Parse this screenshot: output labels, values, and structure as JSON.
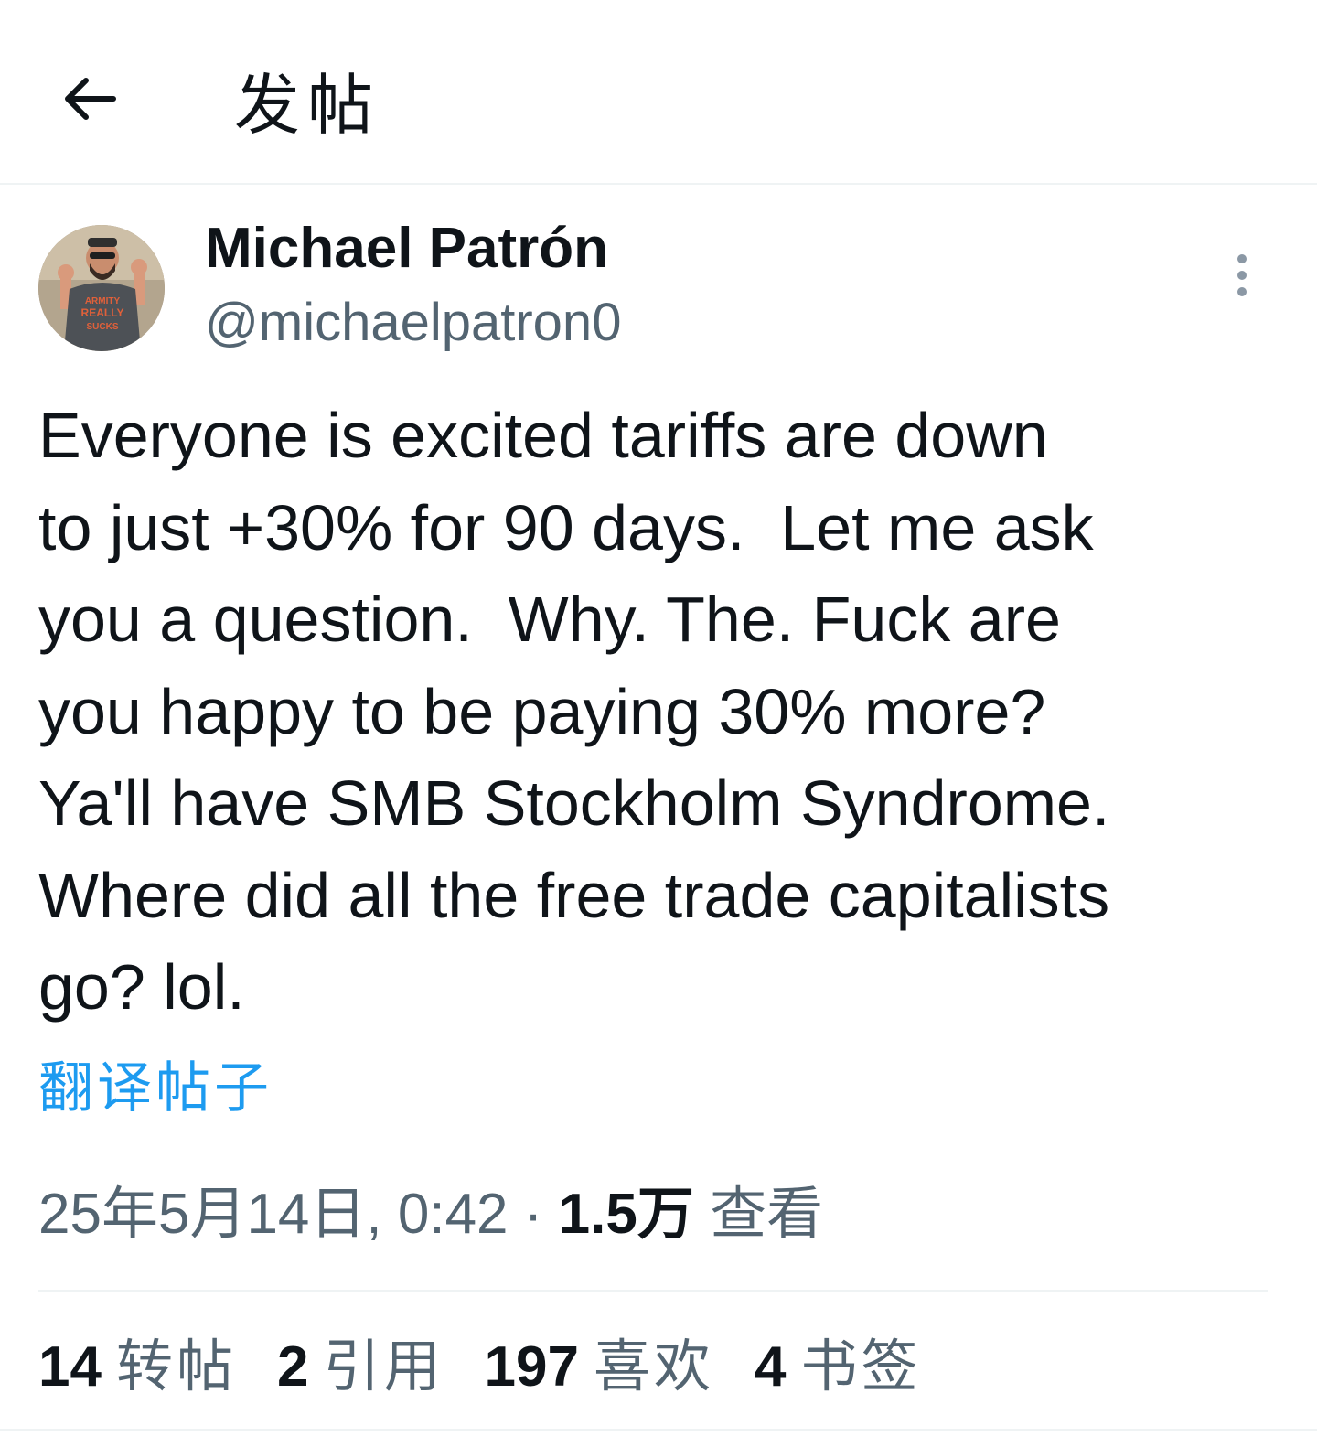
{
  "header": {
    "title": "发帖",
    "back_icon": "arrow-left-icon"
  },
  "author": {
    "name": "Michael Patrón",
    "handle": "@michaelpatron0",
    "avatar_shirt_text": [
      "ARMITY",
      "REALLY",
      "SUCKS"
    ]
  },
  "tweet": {
    "text": "Everyone is excited tariffs are down\nto just +30% for 90 days.  Let me ask\nyou a question.  Why. The. Fuck are\nyou happy to be paying 30% more?\nYa'll have SMB Stockholm Syndrome.\nWhere did all the free trade capitalists\ngo? lol.",
    "translate_label": "翻译帖子"
  },
  "meta": {
    "timestamp": "25年5月14日, 0:42",
    "separator": " · ",
    "views_count": "1.5万",
    "views_label": " 查看"
  },
  "stats": [
    {
      "count": "14",
      "label": "转帖"
    },
    {
      "count": "2",
      "label": "引用"
    },
    {
      "count": "197",
      "label": "喜欢"
    },
    {
      "count": "4",
      "label": "书签"
    }
  ],
  "colors": {
    "text_primary": "#0f1419",
    "text_secondary": "#536471",
    "link": "#1d9bf0",
    "divider": "#eff3f4"
  }
}
